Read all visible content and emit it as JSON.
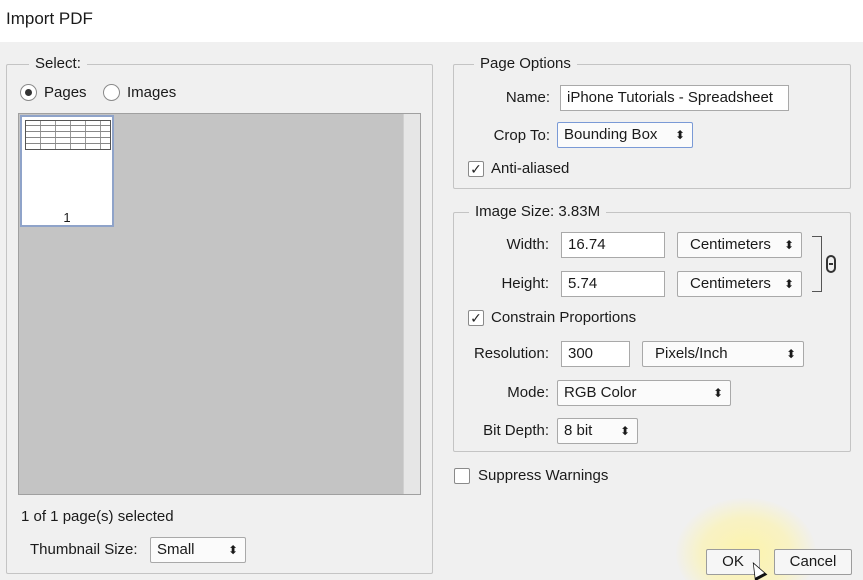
{
  "window": {
    "title": "Import PDF"
  },
  "select": {
    "legend": "Select:",
    "radio_pages": "Pages",
    "radio_images": "Images",
    "selected_mode": "Pages",
    "thumbnail_page_number": "1",
    "selection_status": "1 of 1 page(s) selected",
    "thumbnail_size_label": "Thumbnail Size:",
    "thumbnail_size_value": "Small"
  },
  "page_options": {
    "legend": "Page Options",
    "name_label": "Name:",
    "name_value": "iPhone Tutorials  - Spreadsheet",
    "crop_label": "Crop To:",
    "crop_value": "Bounding Box",
    "anti_aliased_label": "Anti-aliased",
    "anti_aliased_checked": true
  },
  "image_size": {
    "legend": "Image Size: 3.83M",
    "width_label": "Width:",
    "width_value": "16.74",
    "width_unit": "Centimeters",
    "height_label": "Height:",
    "height_value": "5.74",
    "height_unit": "Centimeters",
    "constrain_label": "Constrain Proportions",
    "constrain_checked": true,
    "resolution_label": "Resolution:",
    "resolution_value": "300",
    "resolution_unit": "Pixels/Inch",
    "mode_label": "Mode:",
    "mode_value": "RGB Color",
    "bit_depth_label": "Bit Depth:",
    "bit_depth_value": "8 bit"
  },
  "suppress_warnings": {
    "label": "Suppress Warnings",
    "checked": false
  },
  "buttons": {
    "ok": "OK",
    "cancel": "Cancel"
  },
  "glyphs": {
    "updown": "⬍",
    "check": "✓"
  },
  "icons": [
    "chain-link-icon",
    "updown-arrow-icon",
    "checkmark-icon",
    "mouse-cursor-icon"
  ],
  "colors": {
    "dialog_bg": "#f0f0f0",
    "preview_bg": "#c4c4c4",
    "thumb_border": "#8fa3c9",
    "cursor_highlight": "#fff4a0"
  }
}
